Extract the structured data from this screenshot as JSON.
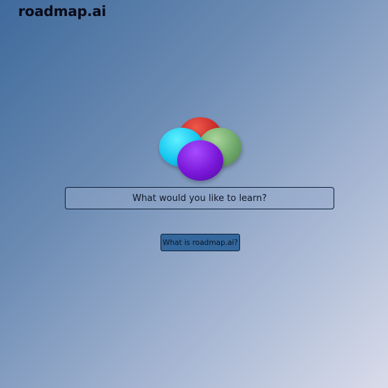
{
  "header": {
    "logo_text": "roadmap.ai"
  },
  "hero": {
    "icon": "four-orbs-logo",
    "colors": {
      "orb_red": "#cc2b2b",
      "orb_green": "#6fa86a",
      "orb_cyan": "#16c6f0",
      "orb_purple": "#7a17d9"
    }
  },
  "search": {
    "value": "",
    "placeholder": "What would you like to learn?"
  },
  "about_button": {
    "label": "What is roadmap.ai?"
  },
  "theme": {
    "background_start": "#3f6a9b",
    "background_end": "#d9dcea",
    "button_color": "#34679c"
  }
}
